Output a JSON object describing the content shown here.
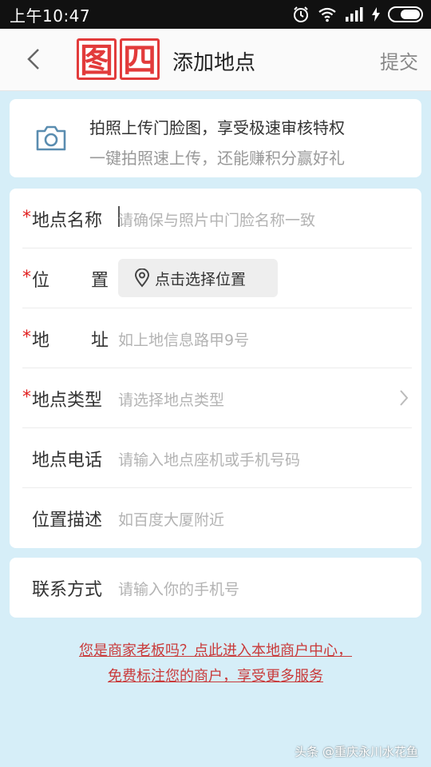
{
  "status_bar": {
    "time": "上午10:47"
  },
  "header": {
    "stamp_chars": [
      "图",
      "四"
    ],
    "title": "添加地点",
    "submit_label": "提交"
  },
  "upload_card": {
    "title": "拍照上传门脸图，享受极速审核特权",
    "subtitle": "一键拍照速上传，还能赚积分赢好礼"
  },
  "form": {
    "required_mark": "*",
    "rows": [
      {
        "label": "地点名称",
        "placeholder": "请确保与照片中门脸名称一致"
      },
      {
        "label_a": "位",
        "label_b": "置",
        "button_label": "点击选择位置"
      },
      {
        "label_a": "地",
        "label_b": "址",
        "placeholder": "如上地信息路甲9号"
      },
      {
        "label": "地点类型",
        "placeholder": "请选择地点类型"
      },
      {
        "label": "地点电话",
        "placeholder": "请输入地点座机或手机号码"
      },
      {
        "label": "位置描述",
        "placeholder": "如百度大厦附近"
      }
    ]
  },
  "contact": {
    "label": "联系方式",
    "placeholder": "请输入你的手机号"
  },
  "promo": {
    "line1": "您是商家老板吗？点此进入本地商户中心，",
    "line2": "免费标注您的商户，享受更多服务"
  },
  "watermark": "头条 @重庆永川水花鱼"
}
